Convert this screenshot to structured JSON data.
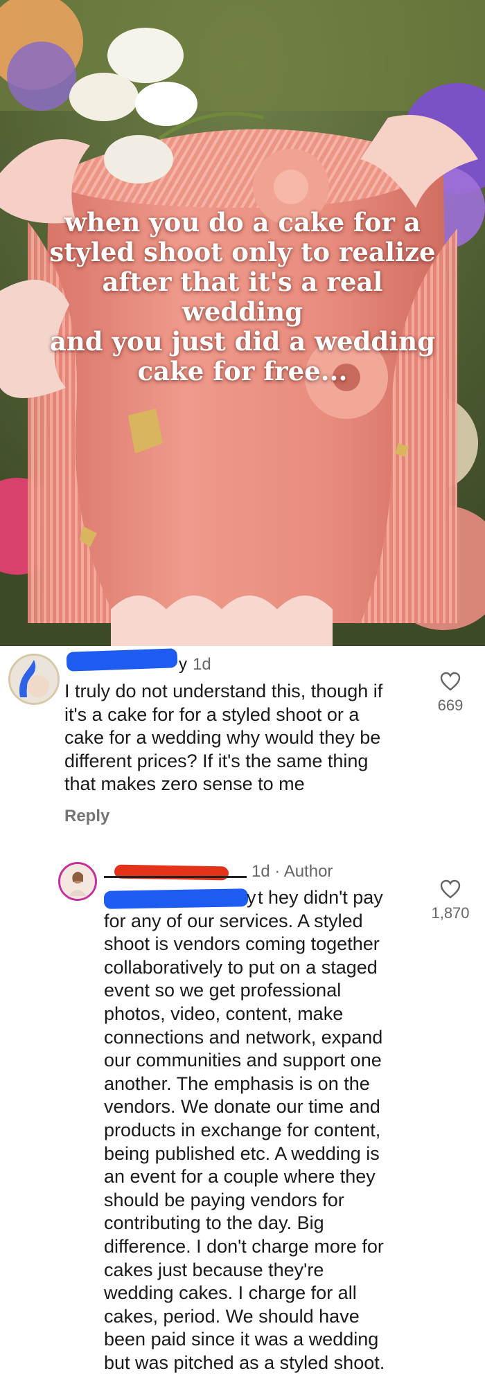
{
  "post": {
    "caption": "when you do a cake for a\nstyled shoot only to realize\nafter that it's a real wedding\nand you just did a wedding\ncake for free..."
  },
  "comments": [
    {
      "time": "1d",
      "text": "I truly do not understand this, though if\nit's a cake for for a styled shoot or a\ncake for a wedding why would they be\ndifferent prices? If it's the same thing\nthat makes zero sense to me",
      "reply_label": "Reply",
      "likes": "669",
      "username_visible_tail": "y"
    },
    {
      "time": "1d · Author",
      "text_first_line": "t hey didn't pay",
      "mention_tail": "y",
      "text": "for any of our services. A styled\nshoot is vendors coming together\ncollaboratively to put on a staged\nevent so we get professional\nphotos, video, content, make\nconnections and network, expand\nour communities and support one\nanother. The emphasis is on the\nvendors. We donate our time and\nproducts in exchange for content,\nbeing published etc. A wedding is\nan event for a couple where they\nshould be paying vendors for\ncontributing to the day. Big\ndifference. I don't charge more for\ncakes just because they're\nwedding cakes. I charge for all\ncakes, period. We should have\nbeen paid since it was a wedding\nbut was pitched as a styled shoot.",
      "likes": "1,870"
    }
  ],
  "icons": {
    "like": "heart-outline-icon"
  },
  "colors": {
    "redaction_blue": "#1e5bf0",
    "redaction_red": "#e33219",
    "author_ring": "#c52f9e",
    "meta_gray": "#666666",
    "cake_pink": "#ea8f82"
  }
}
